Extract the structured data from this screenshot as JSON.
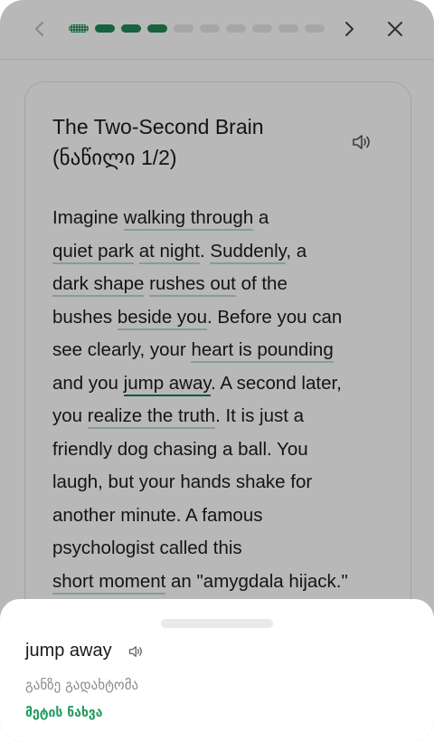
{
  "progress": {
    "total": 10,
    "completed": 3,
    "current_index": 0
  },
  "story": {
    "title_line1": "The Two-Second Brain",
    "title_line2": "(ნაწილი 1/2)",
    "lines": [
      [
        {
          "t": "Imagine "
        },
        {
          "t": "walking through",
          "w": true
        },
        {
          "t": " a"
        }
      ],
      [
        {
          "t": "quiet park",
          "w": true
        },
        {
          "t": " "
        },
        {
          "t": "at night",
          "w": true
        },
        {
          "t": ". "
        },
        {
          "t": "Suddenly",
          "w": true
        },
        {
          "t": ", a"
        }
      ],
      [
        {
          "t": "dark shape",
          "w": true
        },
        {
          "t": " "
        },
        {
          "t": "rushes out",
          "w": true
        },
        {
          "t": " of the"
        }
      ],
      [
        {
          "t": "bushes "
        },
        {
          "t": "beside you",
          "w": true
        },
        {
          "t": ". Before you can"
        }
      ],
      [
        {
          "t": "see clearly, your "
        },
        {
          "t": "heart is pounding",
          "w": true
        }
      ],
      [
        {
          "t": "and you "
        },
        {
          "t": "jump away",
          "w": true,
          "active": true
        },
        {
          "t": ". A second later,"
        }
      ],
      [
        {
          "t": "you "
        },
        {
          "t": "realize the truth",
          "w": true
        },
        {
          "t": ". It is just a"
        }
      ],
      [
        {
          "t": "friendly dog chasing a ball. You"
        }
      ],
      [
        {
          "t": "laugh, but your hands shake for"
        }
      ],
      [
        {
          "t": "another minute. A famous"
        }
      ],
      [
        {
          "t": "psychologist called this"
        }
      ],
      [
        {
          "t": "short moment",
          "w": true
        },
        {
          "t": " an \"amygdala hijack.\""
        }
      ]
    ]
  },
  "sheet": {
    "word": "jump away",
    "translation": "განზე გადახტომა",
    "more_label": "მეტის ნახვა"
  },
  "colors": {
    "accent": "#1f8a55",
    "link": "#1f9a5d",
    "underline": "#b9dccb"
  }
}
